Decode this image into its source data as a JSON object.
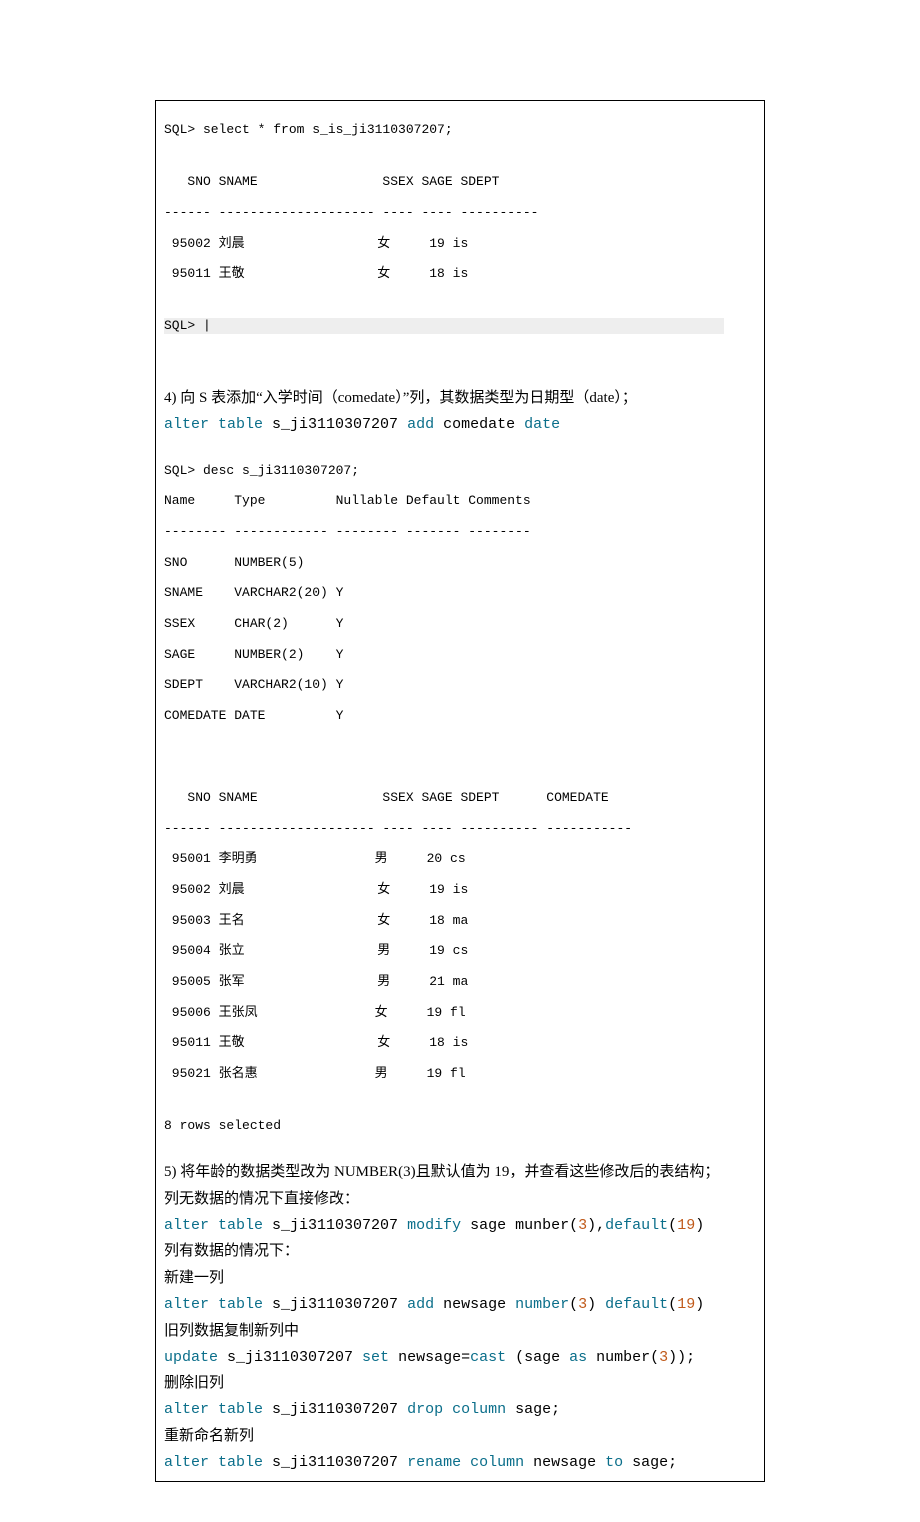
{
  "sql_output_1": {
    "cmd": "SQL> select * from s_is_ji3110307207;",
    "header": "   SNO SNAME                SSEX SAGE SDEPT",
    "divider": "------ -------------------- ---- ---- ----------",
    "rows": [
      " 95002 刘晨                 女     19 is",
      " 95011 王敬                 女     18 is"
    ],
    "prompt": "SQL> "
  },
  "q4": {
    "label": "4)   向 S 表添加“入学时间（comedate）”列，其数据类型为日期型（date）；",
    "code": {
      "p1": "alter",
      "p2": " table",
      "p3": " s_ji3110307207 ",
      "p4": "add",
      "p5": " comedate ",
      "p6": "date"
    }
  },
  "desc_output": {
    "cmd": "SQL> desc s_ji3110307207;",
    "header": "Name     Type         Nullable Default Comments",
    "divider": "-------- ------------ -------- ------- --------",
    "rows": [
      "SNO      NUMBER(5)",
      "SNAME    VARCHAR2(20) Y",
      "SSEX     CHAR(2)      Y",
      "SAGE     NUMBER(2)    Y",
      "SDEPT    VARCHAR2(10) Y",
      "COMEDATE DATE         Y"
    ]
  },
  "sql_output_2": {
    "header": "   SNO SNAME                SSEX SAGE SDEPT      COMEDATE",
    "divider": "------ -------------------- ---- ---- ---------- -----------",
    "rows": [
      " 95001 李明勇               男     20 cs",
      " 95002 刘晨                 女     19 is",
      " 95003 王名                 女     18 ma",
      " 95004 张立                 男     19 cs",
      " 95005 张军                 男     21 ma",
      " 95006 王张凤               女     19 fl",
      " 95011 王敬                 女     18 is",
      " 95021 张名惠               男     19 fl"
    ],
    "footer": "8 rows selected"
  },
  "q5": {
    "label": "5)   将年龄的数据类型改为 NUMBER(3)且默认值为 19，并查看这些修改后的表结构；",
    "line1": "列无数据的情况下直接修改：",
    "code1": {
      "a": "alter",
      "b": " table",
      "c": " s_ji3110307207 ",
      "d": "modify",
      "e": " sage  munber",
      "f": "(",
      "g": "3",
      "h": "),",
      "i": "default",
      "j": "(",
      "k": "19",
      "l": ")"
    },
    "line2": "列有数据的情况下：",
    "line3": "新建一列",
    "code2": {
      "a": "alter",
      "b": " table",
      "c": " s_ji3110307207 ",
      "d": "add",
      "e": " newsage ",
      "f": "number",
      "g": "(",
      "h": "3",
      "i": ") ",
      "j": "default",
      "k": "(",
      "l": "19",
      "m": ")"
    },
    "line4": "旧列数据复制新列中",
    "code3": {
      "a": "update",
      "b": " s_ji3110307207 ",
      "c": "set",
      "d": " newsage=",
      "e": "cast",
      "f": " (sage ",
      "g": "as",
      "h": " number",
      "i": "(",
      "j": "3",
      "k": "));"
    },
    "line5": "删除旧列",
    "code4": {
      "a": "alter",
      "b": " table",
      "c": " s_ji3110307207 ",
      "d": "drop",
      "e": " column",
      "f": " sage;"
    },
    "line6": "重新命名新列",
    "code5": {
      "a": "alter",
      "b": " table",
      "c": " s_ji3110307207 ",
      "d": "rename",
      "e": " column",
      "f": " newsage ",
      "g": "to",
      "h": " sage;"
    }
  }
}
